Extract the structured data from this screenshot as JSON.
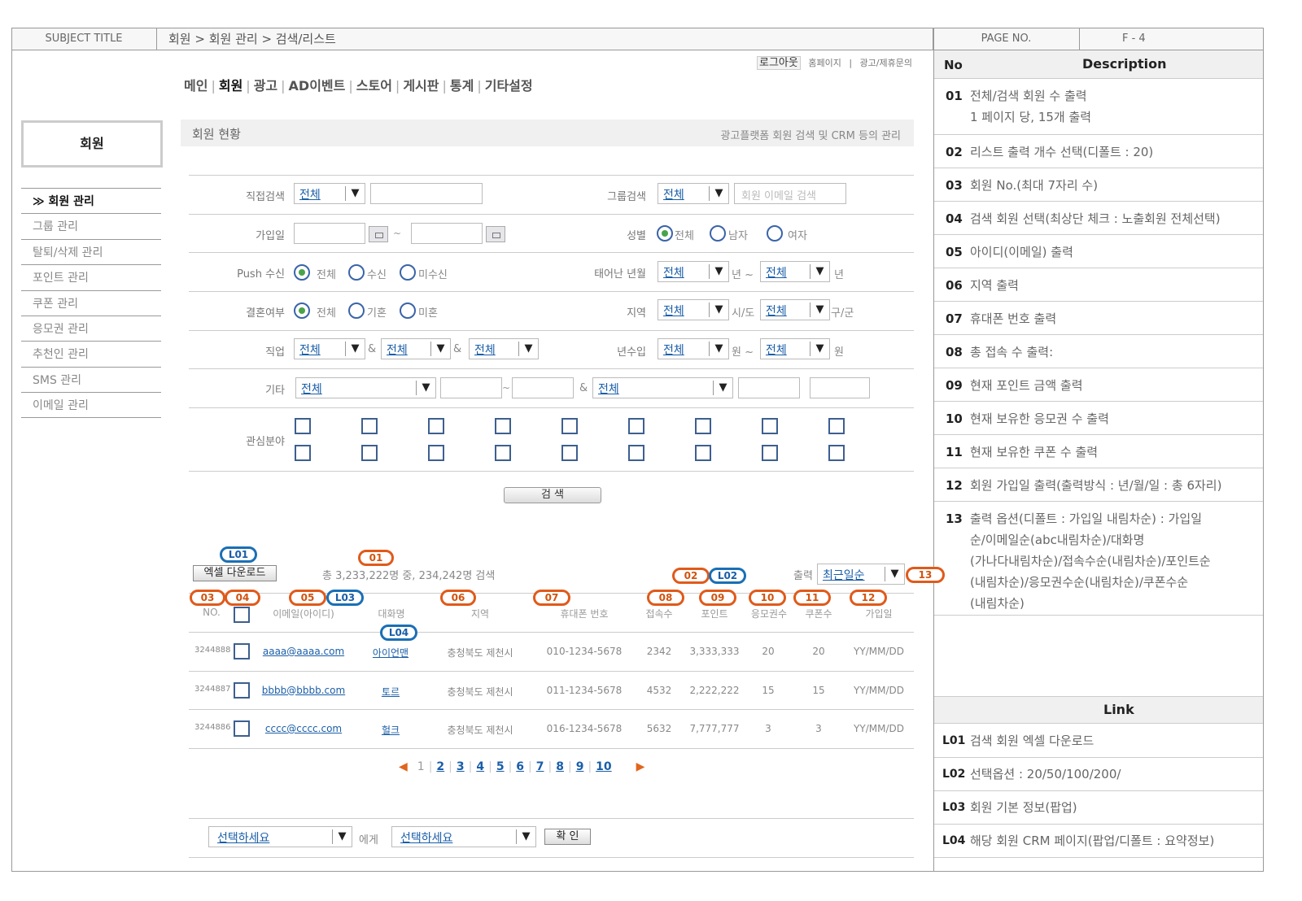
{
  "header": {
    "subject_label": "SUBJECT  TITLE",
    "breadcrumb": "회원 > 회원 관리 > 검색/리스트",
    "page_label": "PAGE  NO.",
    "page_no": "F - 4"
  },
  "toplinks": {
    "logout": "로그아웃",
    "home": "홈페이지",
    "sep": "|",
    "contact": "광고/제휴문의"
  },
  "nav": [
    "메인",
    "회원",
    "광고",
    "AD이벤트",
    "스토어",
    "게시판",
    "통계",
    "기타설정"
  ],
  "sidebar": {
    "title": "회원",
    "items": [
      "≫ 회원 관리",
      "그룹 관리",
      "탈퇴/삭제 관리",
      "포인트 관리",
      "쿠폰 관리",
      "응모권 관리",
      "추천인 관리",
      "SMS 관리",
      "이메일 관리"
    ]
  },
  "section": {
    "title": "회원 현황",
    "desc": "광고플랫폼 회원 검색 및  CRM 등의 관리"
  },
  "form": {
    "direct_search": "직접검색",
    "all": "전체",
    "group_search": "그룹검색",
    "email_placeholder": "회원 이메일 검색",
    "join_date": "가입일",
    "tilde": "~",
    "gender": "성별",
    "gender_all": "전체",
    "male": "남자",
    "female": "여자",
    "push": "Push 수신",
    "push_all": "전체",
    "push_yes": "수신",
    "push_no": "미수신",
    "birth": "태어난 년월",
    "year": "년",
    "year_tilde": "년 ~",
    "married": "결혼여부",
    "married_all": "전체",
    "married_yes": "기혼",
    "married_no": "미혼",
    "region": "지역",
    "sido": "시/도",
    "gugun": "구/군",
    "job": "직업",
    "amp": "&",
    "income": "년수입",
    "won": "원",
    "won_tilde": "원 ~",
    "etc": "기타",
    "interest": "관심분야",
    "search_btn": "검 색"
  },
  "list": {
    "excel": "엑셀 다운로드",
    "total": "총 3,233,222명 중, 234,242명 검색",
    "output_label": "출력",
    "output_value": "최근일순",
    "headers": [
      "NO.",
      "이메일(아이디)",
      "대화명",
      "지역",
      "휴대폰 번호",
      "접속수",
      "포인트",
      "응모권수",
      "쿠폰수",
      "가입일"
    ],
    "rows": [
      [
        "3244888",
        "aaaa@aaaa.com",
        "아이언맨",
        "충청북도 제천시",
        "010-1234-5678",
        "2342",
        "3,333,333",
        "20",
        "20",
        "YY/MM/DD"
      ],
      [
        "3244887",
        "bbbb@bbbb.com",
        "토르",
        "충청북도 제천시",
        "011-1234-5678",
        "4532",
        "2,222,222",
        "15",
        "15",
        "YY/MM/DD"
      ],
      [
        "3244886",
        "cccc@cccc.com",
        "헐크",
        "충청북도 제천시",
        "016-1234-5678",
        "5632",
        "7,777,777",
        "3",
        "3",
        "YY/MM/DD"
      ]
    ],
    "pager": {
      "prev": "◀",
      "next": "▶",
      "current": "1",
      "pages": [
        "2",
        "3",
        "4",
        "5",
        "6",
        "7",
        "8",
        "9",
        "10"
      ]
    },
    "bottom": {
      "select1": "선택하세요",
      "to": "에게",
      "select2": "선택하세요",
      "ok": "확 인"
    }
  },
  "badges": {
    "o": [
      "01",
      "02",
      "03",
      "04",
      "05",
      "06",
      "07",
      "08",
      "09",
      "10",
      "11",
      "12",
      "13"
    ],
    "b": [
      "L01",
      "L02",
      "L03",
      "L04"
    ]
  },
  "panel": {
    "no_header": "No",
    "desc_header": "Description",
    "link_header": "Link",
    "desc": [
      {
        "no": "01",
        "lines": [
          "전체/검색 회원 수 출력",
          "1 페이지 당, 15개 출력"
        ]
      },
      {
        "no": "02",
        "lines": [
          "리스트 출력 개수 선택(디폴트 : 20)"
        ]
      },
      {
        "no": "03",
        "lines": [
          "회원 No.(최대 7자리 수)"
        ]
      },
      {
        "no": "04",
        "lines": [
          "검색 회원 선택(최상단 체크 : 노출회원 전체선택)"
        ]
      },
      {
        "no": "05",
        "lines": [
          "아이디(이메일) 출력"
        ]
      },
      {
        "no": "06",
        "lines": [
          "지역 출력"
        ]
      },
      {
        "no": "07",
        "lines": [
          "휴대폰 번호 출력"
        ]
      },
      {
        "no": "08",
        "lines": [
          "총 접속 수 출력:"
        ]
      },
      {
        "no": "09",
        "lines": [
          "현재 포인트 금액 출력"
        ]
      },
      {
        "no": "10",
        "lines": [
          "현재 보유한 응모권 수 출력"
        ]
      },
      {
        "no": "11",
        "lines": [
          "현재 보유한 쿠폰 수 출력"
        ]
      },
      {
        "no": "12",
        "lines": [
          "회원 가입일 출력(출력방식 : 년/월/일 : 총 6자리)"
        ]
      },
      {
        "no": "13",
        "lines": [
          "출력 옵션(디폴트 : 가입일 내림차순) : 가입일",
          "순/이메일순(abc내림차순)/대화명",
          "(가나다내림차순)/접속수순(내림차순)/포인트순",
          "(내림차순)/응모권수순(내림차순)/쿠폰수순",
          "(내림차순)"
        ]
      }
    ],
    "links": [
      {
        "no": "L01",
        "text": "검색 회원 엑셀 다운로드"
      },
      {
        "no": "L02",
        "text": "선택옵션 : 20/50/100/200/"
      },
      {
        "no": "L03",
        "text": "회원 기본 정보(팝업)"
      },
      {
        "no": "L04",
        "text": "해당 회원 CRM 페이지(팝업/디폴트 : 요약정보)"
      }
    ]
  },
  "colors": {
    "accent_orange": "#e05a1a",
    "accent_blue": "#1a6fb5",
    "link": "#1a5ea8"
  }
}
